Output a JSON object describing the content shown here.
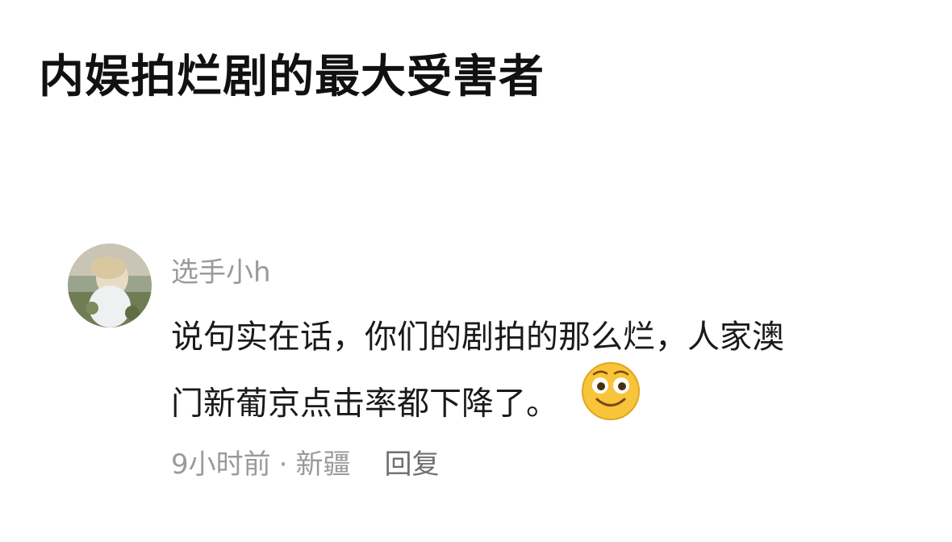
{
  "title": "内娱拍烂剧的最大受害者",
  "comment": {
    "username": "选手小h",
    "text_line1": "说句实在话，你们的剧拍的那么烂，人家澳",
    "text_line2": "门新葡京点击率都下降了。",
    "emoji_icon": "smile-emoji-icon",
    "time": "9小时前",
    "separator": "·",
    "location": "新疆",
    "reply_label": "回复"
  },
  "colors": {
    "title": "#111111",
    "text": "#1a1a1a",
    "meta": "#9a9a9a",
    "emoji_face": "#f7c43a"
  }
}
